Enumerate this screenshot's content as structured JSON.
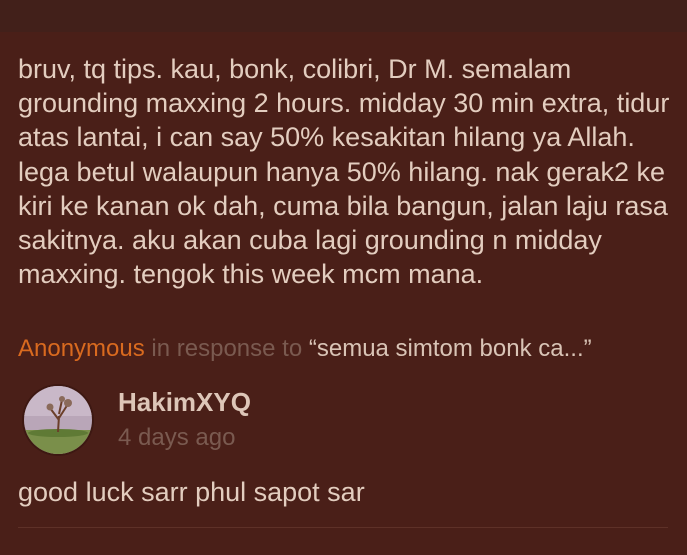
{
  "post": {
    "body": "bruv, tq tips. kau, bonk, colibri, Dr M. semalam grounding maxxing 2 hours. midday 30 min extra, tidur atas lantai, i can say 50% kesakitan hilang ya Allah. lega betul walaupun hanya 50% hilang. nak gerak2 ke kiri ke kanan ok dah, cuma bila bangun, jalan laju rasa sakitnya. aku akan cuba lagi grounding n midday maxxing. tengok this week mcm mana.",
    "author": "Anonymous",
    "in_response_to_label": "in response to",
    "quoted_text": "“semua simtom bonk ca...”"
  },
  "reply": {
    "avatar_icon": "avatar-tree-photo",
    "author": "HakimXYQ",
    "time": "4 days ago",
    "body": "good luck sarr phul sapot sar"
  },
  "colors": {
    "background": "#4a1f18",
    "author_accent": "#d96a1f",
    "text": "#e3cdbf",
    "muted": "#7a5a50"
  }
}
